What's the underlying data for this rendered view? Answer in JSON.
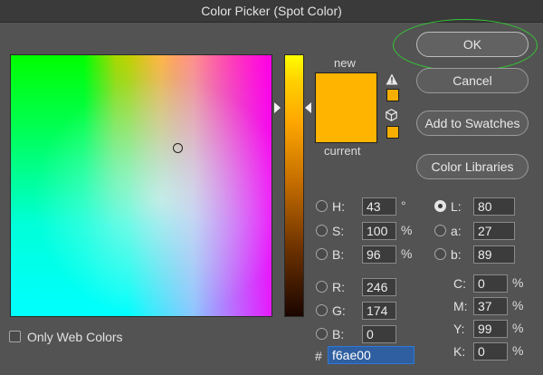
{
  "window": {
    "title": "Color Picker (Spot Color)"
  },
  "preview": {
    "new_label": "new",
    "current_label": "current",
    "new_color": "#ffb400",
    "current_color": "#ffb400",
    "gamut_swatch_color": "#f6ae00",
    "web_swatch_color": "#f6ae00"
  },
  "icons": {
    "warning": "warning-icon",
    "cube": "cube-icon"
  },
  "buttons": {
    "ok": "OK",
    "cancel": "Cancel",
    "add_to_swatches": "Add to Swatches",
    "color_libraries": "Color Libraries"
  },
  "hsb": {
    "h": {
      "label": "H:",
      "value": "43",
      "unit": "°"
    },
    "s": {
      "label": "S:",
      "value": "100",
      "unit": "%"
    },
    "b": {
      "label": "B:",
      "value": "96",
      "unit": "%"
    }
  },
  "rgb": {
    "r": {
      "label": "R:",
      "value": "246"
    },
    "g": {
      "label": "G:",
      "value": "174"
    },
    "b": {
      "label": "B:",
      "value": "0"
    }
  },
  "lab": {
    "l": {
      "label": "L:",
      "value": "80"
    },
    "a": {
      "label": "a:",
      "value": "27"
    },
    "b": {
      "label": "b:",
      "value": "89"
    }
  },
  "cmyk": {
    "c": {
      "label": "C:",
      "value": "0",
      "unit": "%"
    },
    "m": {
      "label": "M:",
      "value": "37",
      "unit": "%"
    },
    "y": {
      "label": "Y:",
      "value": "99",
      "unit": "%"
    },
    "k": {
      "label": "K:",
      "value": "0",
      "unit": "%"
    }
  },
  "hex": {
    "label": "#",
    "value": "f6ae00"
  },
  "only_web_colors": {
    "label": "Only Web Colors",
    "checked": false
  },
  "selected_mode": "L"
}
